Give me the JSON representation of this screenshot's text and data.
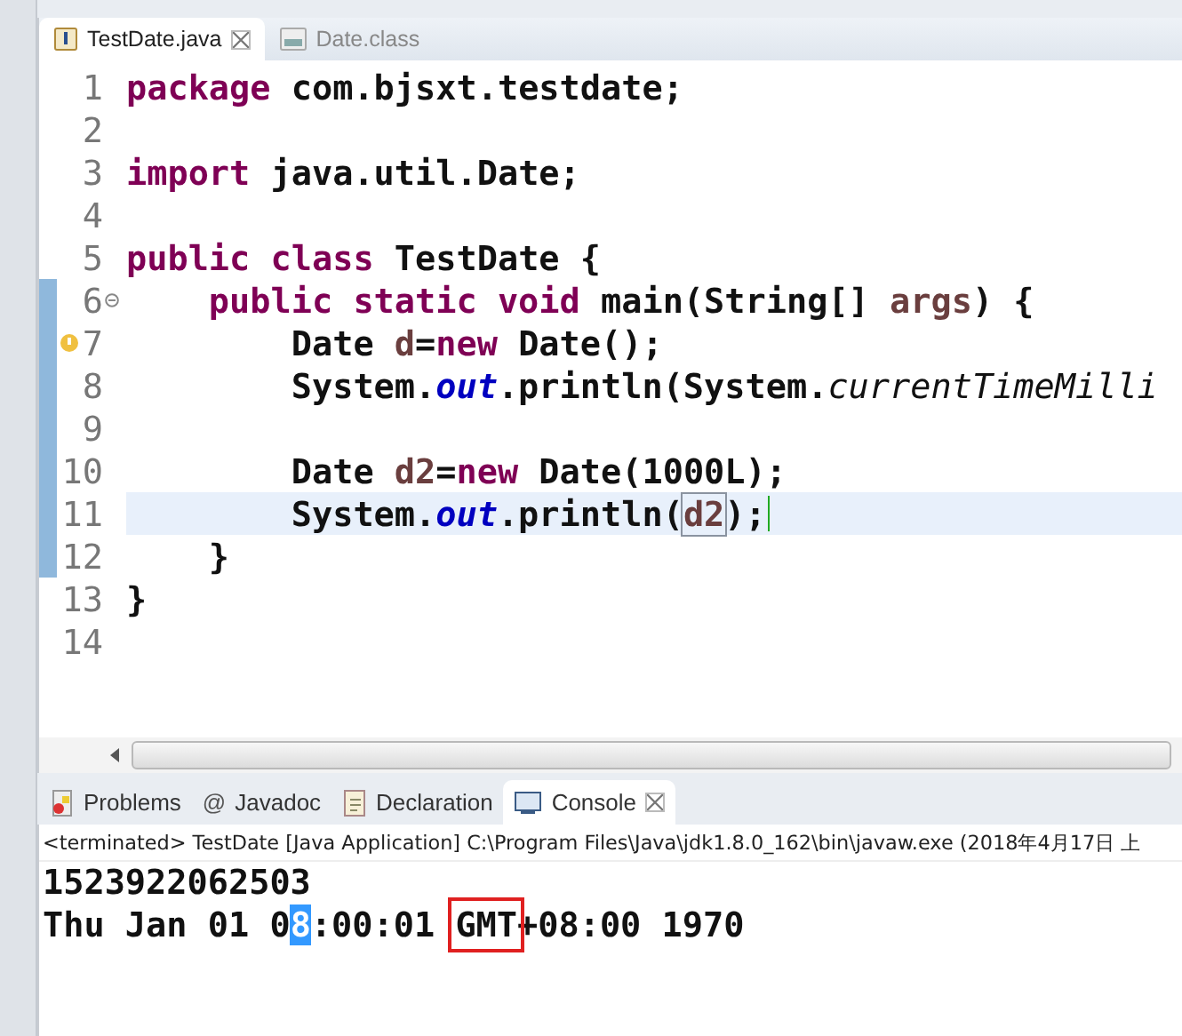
{
  "editor_tabs": [
    {
      "label": "TestDate.java",
      "selected": true
    },
    {
      "label": "Date.class",
      "selected": false
    }
  ],
  "code": {
    "lines": [
      {
        "number": "1",
        "tokens": [
          {
            "t": "package",
            "kind": "keyword"
          },
          {
            "t": " com.bjsxt.testdate;",
            "kind": "plain"
          }
        ]
      },
      {
        "number": "2"
      },
      {
        "number": "3",
        "tokens": [
          {
            "t": "import",
            "kind": "keyword"
          },
          {
            "t": " java.util.Date;",
            "kind": "plain"
          }
        ]
      },
      {
        "number": "4"
      },
      {
        "number": "5",
        "tokens": [
          {
            "t": "public class",
            "kind": "keyword"
          },
          {
            "t": " TestDate {",
            "kind": "plain"
          }
        ]
      },
      {
        "number": "6",
        "foldable": true,
        "tokens": [
          {
            "t": "    public static void",
            "kind": "keyword"
          },
          {
            "t": " main(String[] ",
            "kind": "plain"
          },
          {
            "t": "args",
            "kind": "variable"
          },
          {
            "t": ") {",
            "kind": "plain"
          }
        ]
      },
      {
        "number": "7",
        "warning": true,
        "tokens": [
          {
            "t": "        Date ",
            "kind": "plain"
          },
          {
            "t": "d",
            "kind": "variable"
          },
          {
            "t": "=",
            "kind": "plain"
          },
          {
            "t": "new",
            "kind": "keyword"
          },
          {
            "t": " Date();",
            "kind": "plain"
          }
        ]
      },
      {
        "number": "8",
        "tokens": [
          {
            "t": "        System.",
            "kind": "plain"
          },
          {
            "t": "out",
            "kind": "field"
          },
          {
            "t": ".println(System.",
            "kind": "plain"
          },
          {
            "t": "currentTimeMilli",
            "kind": "static"
          }
        ]
      },
      {
        "number": "9"
      },
      {
        "number": "10",
        "tokens": [
          {
            "t": "        Date ",
            "kind": "plain"
          },
          {
            "t": "d2",
            "kind": "variable"
          },
          {
            "t": "=",
            "kind": "plain"
          },
          {
            "t": "new",
            "kind": "keyword"
          },
          {
            "t": " Date(1000L);",
            "kind": "plain"
          }
        ]
      },
      {
        "number": "11",
        "current": true,
        "tokens": [
          {
            "t": "        System.",
            "kind": "plain"
          },
          {
            "t": "out",
            "kind": "field"
          },
          {
            "t": ".println(",
            "kind": "plain"
          },
          {
            "t": "d2",
            "kind": "match"
          },
          {
            "t": ");",
            "kind": "plain"
          }
        ]
      },
      {
        "number": "12",
        "tokens": [
          {
            "t": "    }",
            "kind": "plain"
          }
        ]
      },
      {
        "number": "13",
        "tokens": [
          {
            "t": "}",
            "kind": "plain"
          }
        ]
      },
      {
        "number": "14"
      }
    ]
  },
  "view_tabs": [
    {
      "label": "Problems",
      "selected": false
    },
    {
      "label": "Javadoc",
      "selected": false
    },
    {
      "label": "Declaration",
      "selected": false
    },
    {
      "label": "Console",
      "selected": true
    }
  ],
  "javadoc_symbol": "@",
  "console": {
    "status": "<terminated> TestDate [Java Application] C:\\Program Files\\Java\\jdk1.8.0_162\\bin\\javaw.exe (2018年4月17日 上",
    "output": [
      [
        {
          "text": "1523922062503",
          "kind": "plain"
        }
      ],
      [
        {
          "text": "Thu Jan 01 0",
          "kind": "plain"
        },
        {
          "text": "8",
          "kind": "selected"
        },
        {
          "text": ":00:01 ",
          "kind": "plain"
        },
        {
          "text": "GMT",
          "kind": "boxed"
        },
        {
          "text": "+08:00 1970",
          "kind": "plain"
        }
      ]
    ]
  }
}
